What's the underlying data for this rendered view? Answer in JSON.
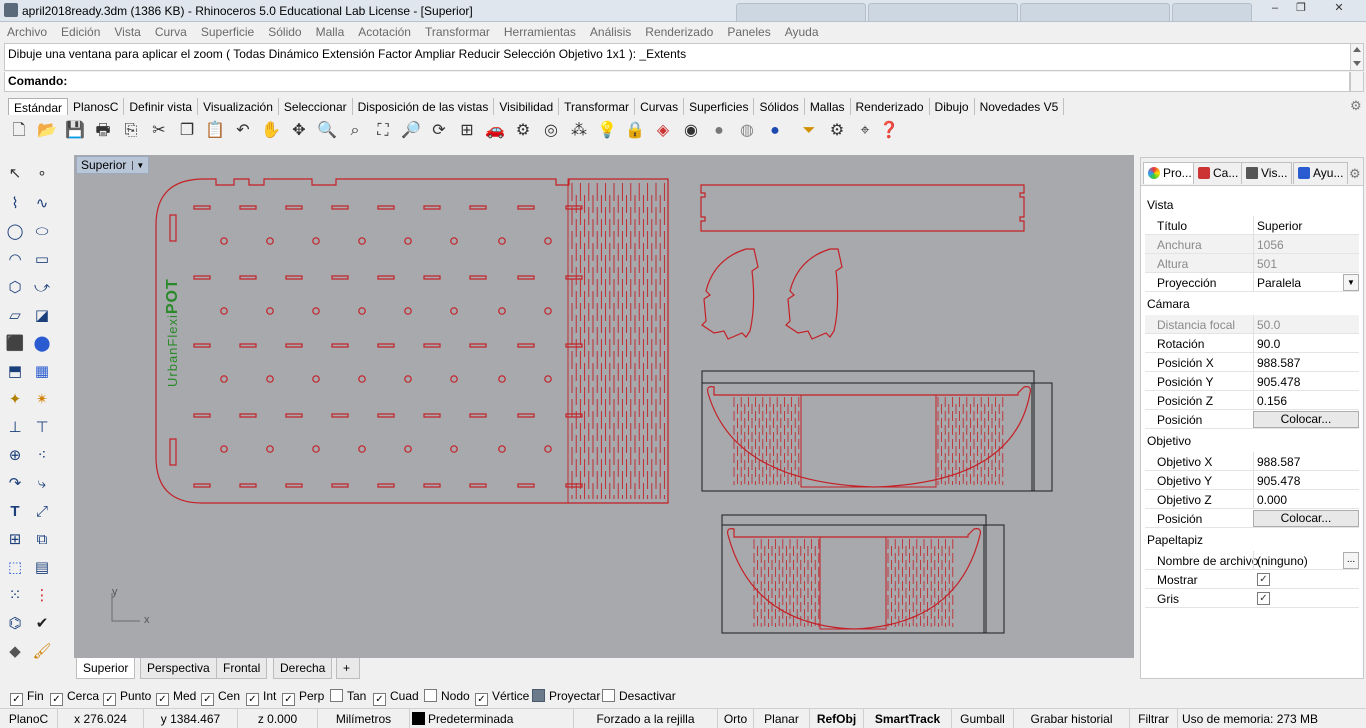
{
  "window": {
    "title": "april2018ready.3dm (1386 KB) - Rhinoceros 5.0 Educational Lab License - [Superior]",
    "controls": {
      "minimize": "–",
      "maximize": "❐",
      "close": "✕"
    }
  },
  "menu": [
    "Archivo",
    "Edición",
    "Vista",
    "Curva",
    "Superficie",
    "Sólido",
    "Malla",
    "Acotación",
    "Transformar",
    "Herramientas",
    "Análisis",
    "Renderizado",
    "Paneles",
    "Ayuda"
  ],
  "command": {
    "history": "Dibuje una ventana para aplicar el zoom ( Todas  Dinámico  Extensión  Factor  Ampliar  Reducir  Selección  Objetivo  1x1 ): _Extents",
    "prompt_label": "Comando:"
  },
  "toolbar_tabs": [
    "Estándar",
    "PlanosC",
    "Definir vista",
    "Visualización",
    "Seleccionar",
    "Disposición de las vistas",
    "Visibilidad",
    "Transformar",
    "Curvas",
    "Superficies",
    "Sólidos",
    "Mallas",
    "Renderizado",
    "Dibujo",
    "Novedades V5"
  ],
  "toolbar_icons": [
    "new-file",
    "open-file",
    "save",
    "print",
    "import",
    "cut",
    "copy",
    "paste",
    "undo",
    "pan",
    "rotate-view",
    "zoom",
    "zoom-window",
    "zoom-extents",
    "zoom-selected",
    "rotate",
    "four-viewports",
    "car-render",
    "object-properties",
    "osnap",
    "select-points",
    "light",
    "lock",
    "layer",
    "color-wheel",
    "shaded-sphere",
    "rendered-sphere",
    "blue-sphere",
    "filter",
    "options",
    "gumball-icon",
    "help"
  ],
  "left_toolbar_icons": [
    "point",
    "point-cloud",
    "polyline",
    "curve",
    "circle",
    "ellipse",
    "arc",
    "rectangle",
    "polygon",
    "free-form",
    "surface",
    "loft",
    "box",
    "sphere",
    "extrude",
    "mesh",
    "boolean",
    "explode",
    "trim",
    "split",
    "join",
    "group",
    "fillet",
    "offset",
    "text",
    "dimension",
    "array",
    "mirror",
    "block",
    "hatch",
    "grid-array",
    "align",
    "curve-tools",
    "check",
    "solid-tools",
    "paint"
  ],
  "viewport": {
    "name": "Superior",
    "logo_text_main": "UrbanFlexi",
    "logo_text_accent": "POT",
    "axis_y": "y",
    "axis_x": "x",
    "colors": {
      "background": "#a8a9ad",
      "cut_lines": "#c42026",
      "frames": "#1a1a1a",
      "logo": "#2a8a2a"
    }
  },
  "viewport_tabs": [
    "Superior",
    "Perspectiva",
    "Frontal",
    "Derecha"
  ],
  "panel": {
    "tabs": [
      "Pro...",
      "Ca...",
      "Vis...",
      "Ayu..."
    ],
    "vista": {
      "heading": "Vista",
      "titulo_label": "Título",
      "titulo_value": "Superior",
      "anchura_label": "Anchura",
      "anchura_value": "1056",
      "altura_label": "Altura",
      "altura_value": "501",
      "proyeccion_label": "Proyección",
      "proyeccion_value": "Paralela"
    },
    "camara": {
      "heading": "Cámara",
      "distancia_label": "Distancia focal",
      "distancia_value": "50.0",
      "rotacion_label": "Rotación",
      "rotacion_value": "90.0",
      "px_label": "Posición X",
      "px_value": "988.587",
      "py_label": "Posición Y",
      "py_value": "905.478",
      "pz_label": "Posición Z",
      "pz_value": "0.156",
      "pos_label": "Posición",
      "pos_button": "Colocar..."
    },
    "objetivo": {
      "heading": "Objetivo",
      "ox_label": "Objetivo X",
      "ox_value": "988.587",
      "oy_label": "Objetivo Y",
      "oy_value": "905.478",
      "oz_label": "Objetivo Z",
      "oz_value": "0.000",
      "pos_label": "Posición",
      "pos_button": "Colocar..."
    },
    "papeltapiz": {
      "heading": "Papeltapiz",
      "nombre_label": "Nombre de archivo",
      "nombre_value": "(ninguno)",
      "nombre_button": "...",
      "mostrar_label": "Mostrar",
      "mostrar_checked": true,
      "gris_label": "Gris",
      "gris_checked": true
    }
  },
  "osnap": [
    {
      "label": "Fin",
      "checked": true
    },
    {
      "label": "Cerca",
      "checked": true
    },
    {
      "label": "Punto",
      "checked": true
    },
    {
      "label": "Med",
      "checked": true
    },
    {
      "label": "Cen",
      "checked": true
    },
    {
      "label": "Int",
      "checked": true
    },
    {
      "label": "Perp",
      "checked": true
    },
    {
      "label": "Tan",
      "checked": false
    },
    {
      "label": "Cuad",
      "checked": true
    },
    {
      "label": "Nodo",
      "checked": false
    },
    {
      "label": "Vértice",
      "checked": true
    },
    {
      "label": "Proyectar",
      "checked": true
    },
    {
      "label": "Desactivar",
      "checked": false
    }
  ],
  "status": {
    "cplane": "PlanoC",
    "x": "x 276.024",
    "y": "y 1384.467",
    "z": "z 0.000",
    "units": "Milímetros",
    "layer": "Predeterminada",
    "grid_snap": "Forzado a la rejilla",
    "ortho": "Orto",
    "planar": "Planar",
    "osnap": "RefObj",
    "smarttrack": "SmartTrack",
    "gumball": "Gumball",
    "history": "Grabar historial",
    "filter": "Filtrar",
    "memory": "Uso de memoria: 273 MB"
  }
}
